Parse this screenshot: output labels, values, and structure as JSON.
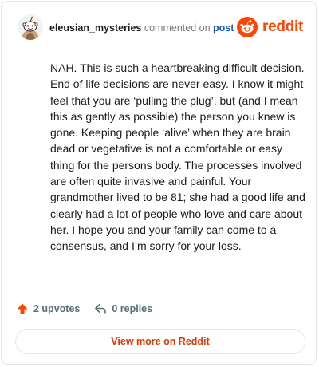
{
  "header": {
    "username": "eleusian_mysteries",
    "action_text": "commented on",
    "post_link_text": "post",
    "brand_word": "reddit"
  },
  "comment": {
    "body": "NAH. This is such a heartbreaking difficult decision. End of life decisions are never easy. I know it might feel that you are ‘pulling the plug’, but (and I mean this as gently as possible) the person you knew is gone. Keeping people ‘alive’ when they are brain dead or vegetative is not a comfortable or easy thing for the persons body. The processes involved are often quite invasive and painful. Your grandmother lived to be 81; she had a good life and clearly had a lot of people who love and care about her. I hope you and your family can come to a consensus, and I’m sorry for your loss."
  },
  "footer": {
    "upvotes_label": "2 upvotes",
    "replies_label": "0 replies",
    "upvote_icon": "arrow-up-icon",
    "reply_icon": "reply-arrow-icon"
  },
  "view_more_label": "View more on Reddit",
  "colors": {
    "brand_orange": "#ff4500",
    "link_blue": "#1a5cc4",
    "view_more_red": "#d93a00",
    "muted_text": "#576f76",
    "border": "#e4e6e8"
  }
}
